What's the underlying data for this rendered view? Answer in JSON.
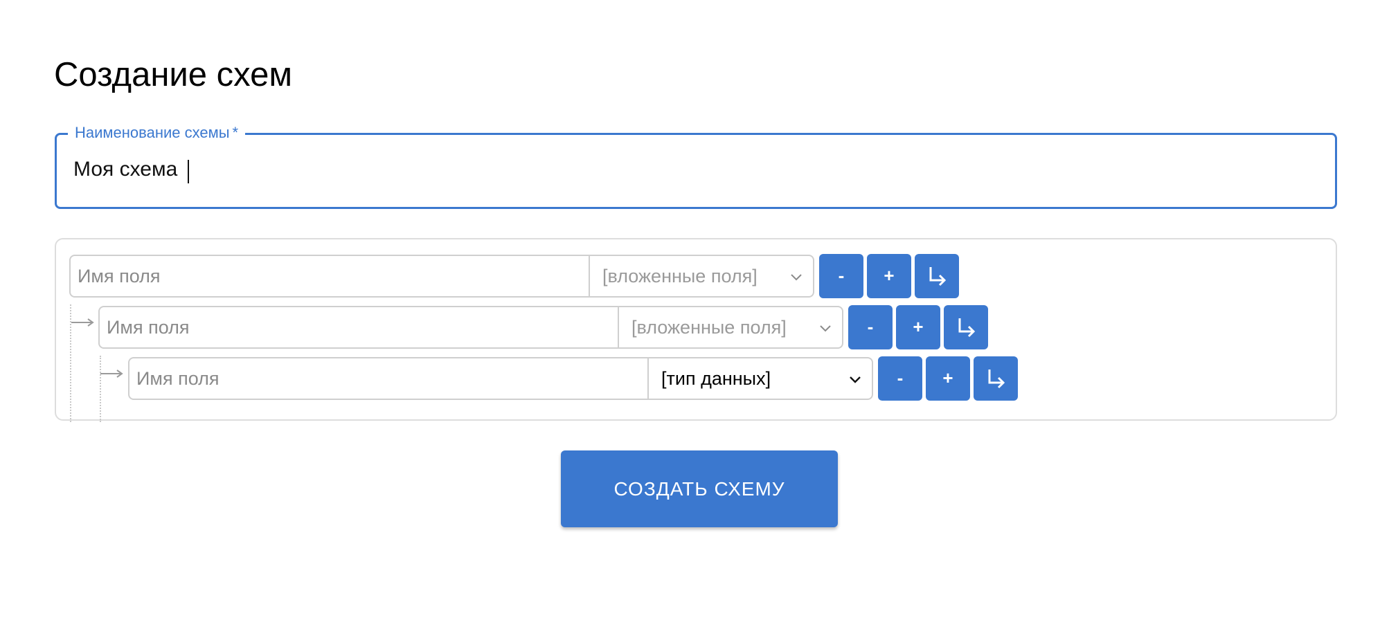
{
  "page": {
    "title": "Создание схем"
  },
  "schema_name": {
    "label": "Наименование схемы",
    "required_mark": "*",
    "value": "Моя схема"
  },
  "fields": [
    {
      "name_placeholder": "Имя поля",
      "select_value": "[вложенные поля]",
      "buttons": {
        "remove": "-",
        "add": "+",
        "nest_icon": "return-arrow-icon"
      }
    },
    {
      "name_placeholder": "Имя поля",
      "select_value": "[вложенные поля]",
      "buttons": {
        "remove": "-",
        "add": "+",
        "nest_icon": "return-arrow-icon"
      }
    },
    {
      "name_placeholder": "Имя поля",
      "select_value": "[тип данных]",
      "buttons": {
        "remove": "-",
        "add": "+",
        "nest_icon": "return-arrow-icon"
      }
    }
  ],
  "actions": {
    "create_label": "СОЗДАТЬ СХЕМУ"
  },
  "colors": {
    "accent": "#3b78cf",
    "border": "#cfcfcf",
    "muted_text": "#9a9a9a"
  }
}
